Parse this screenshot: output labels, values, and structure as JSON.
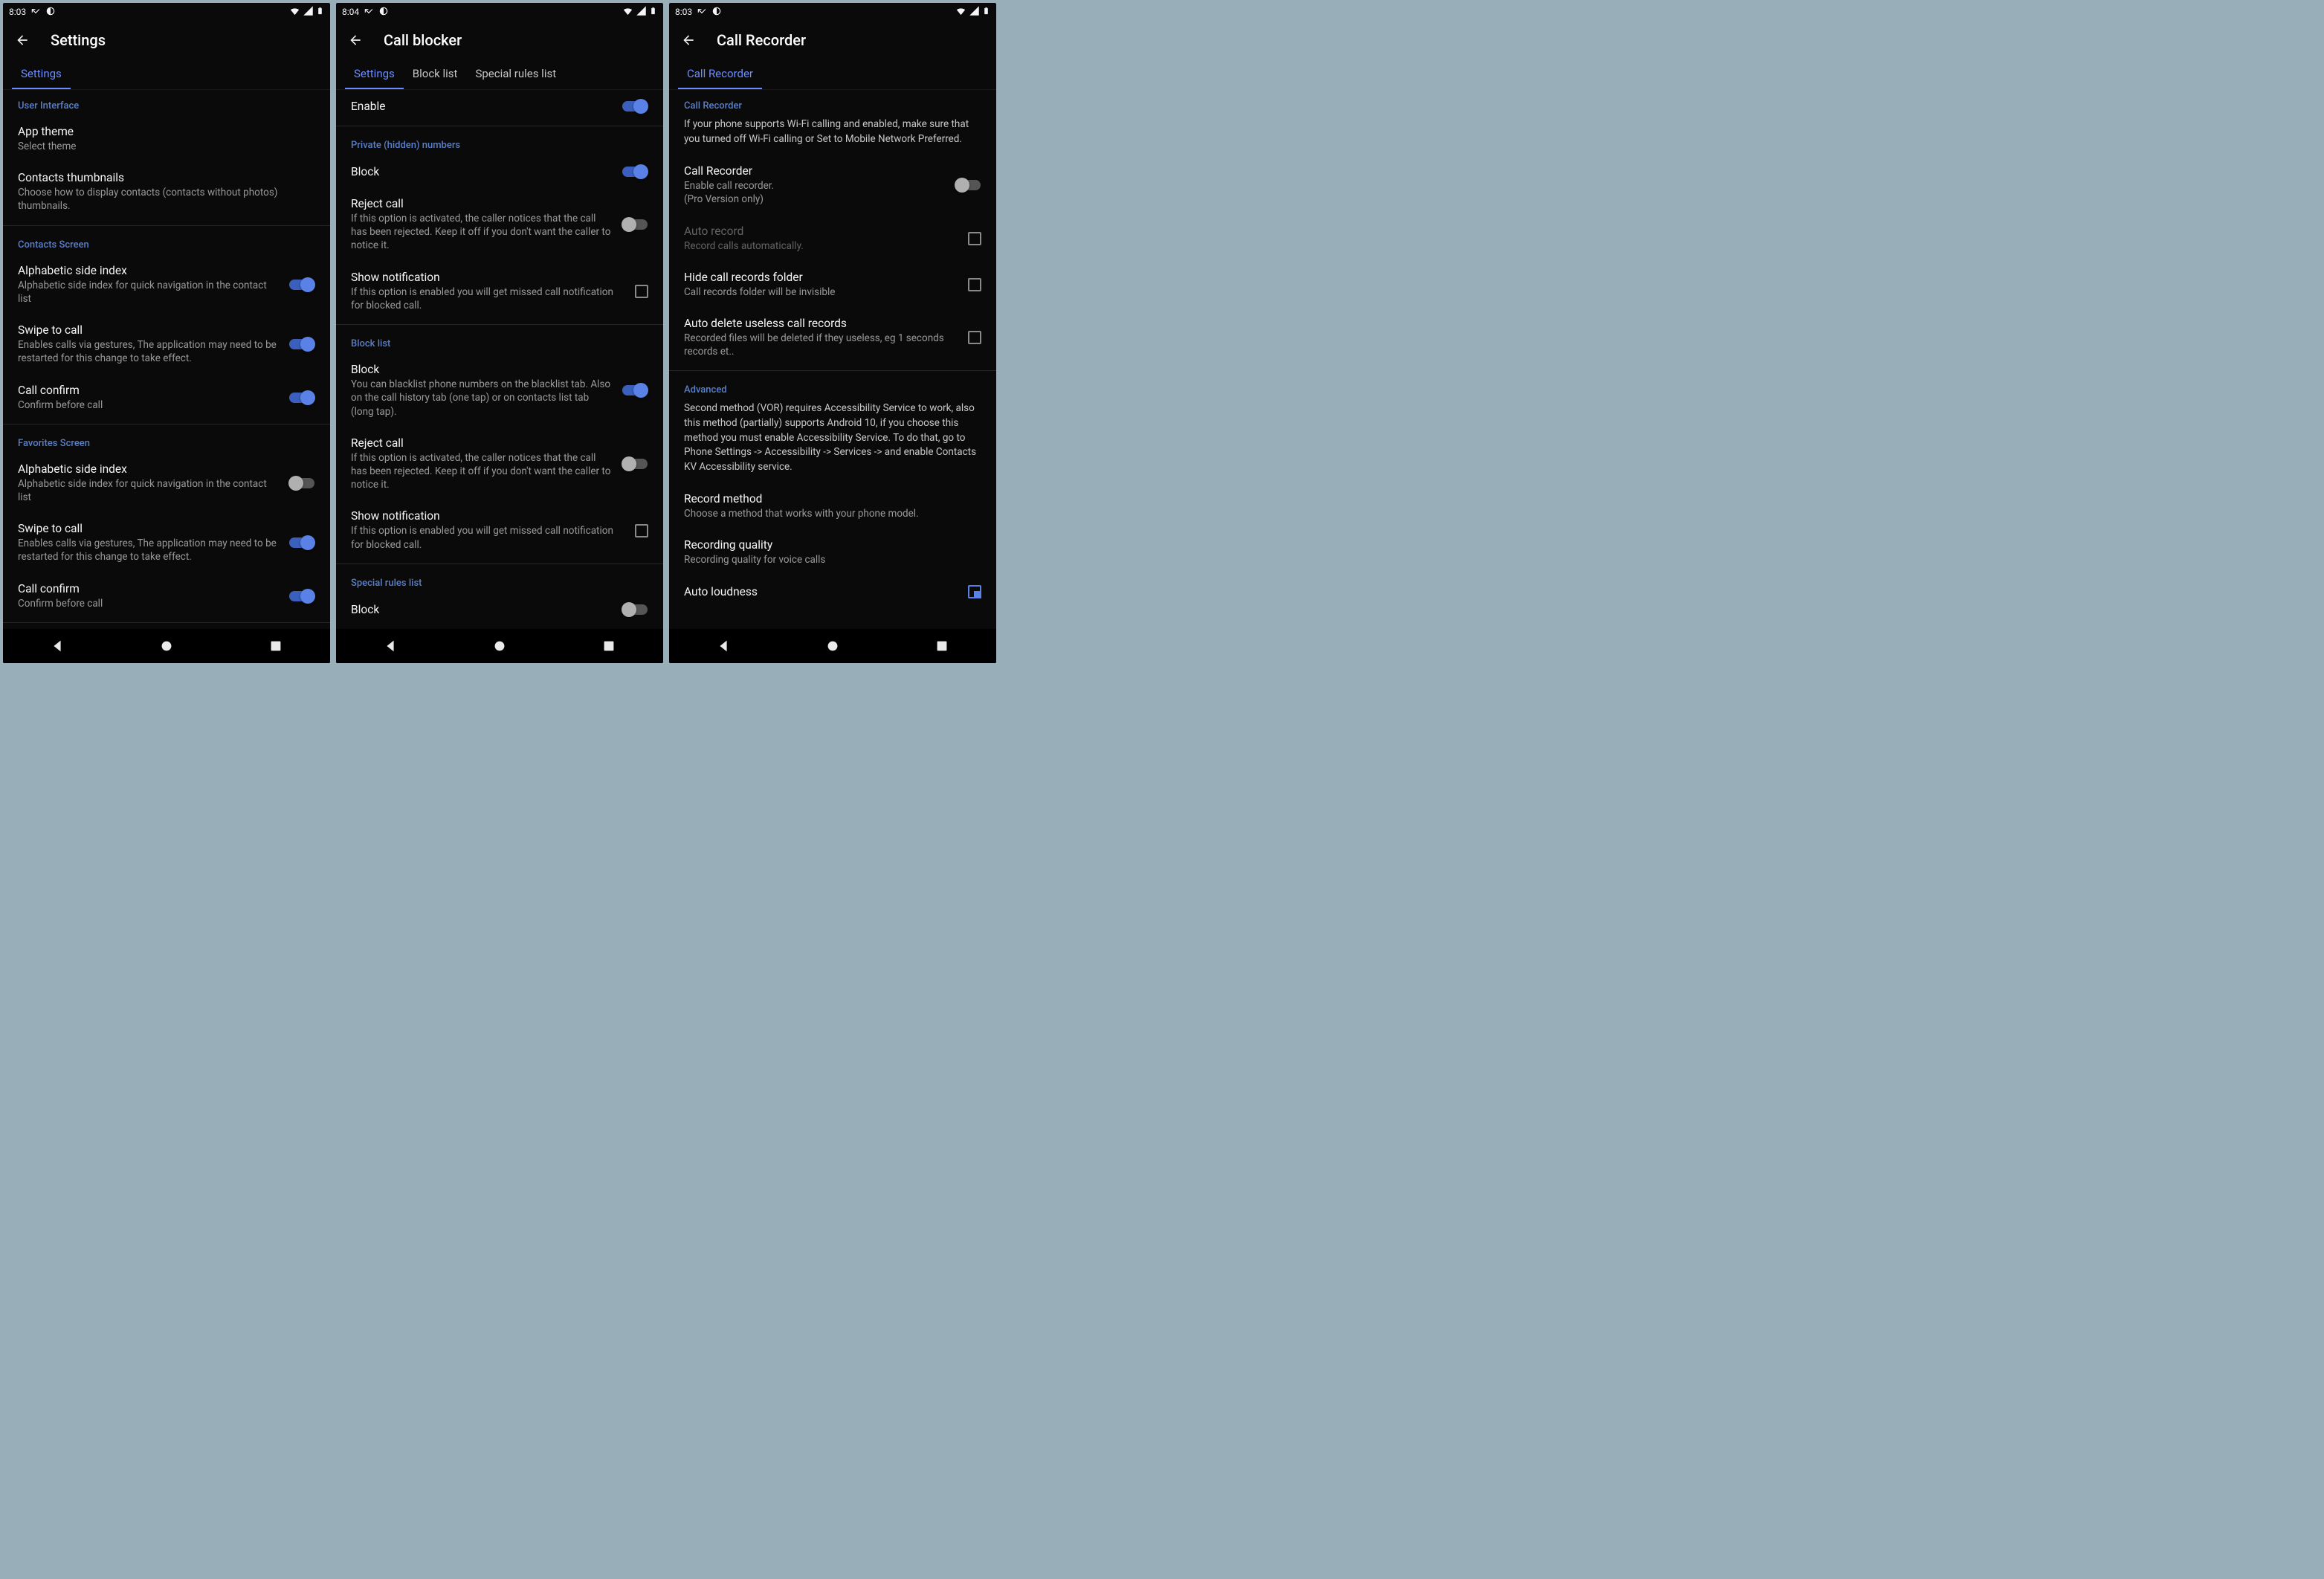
{
  "status_times": [
    "8:03",
    "8:04",
    "8:03"
  ],
  "screens": [
    {
      "title": "Settings",
      "tabs": [
        {
          "label": "Settings",
          "active": true
        }
      ],
      "blocks": [
        {
          "type": "section",
          "label": "User Interface"
        },
        {
          "type": "item",
          "title": "App theme",
          "sub": "Select theme"
        },
        {
          "type": "item",
          "title": "Contacts thumbnails",
          "sub": "Choose how to display contacts (contacts without photos) thumbnails."
        },
        {
          "type": "divider"
        },
        {
          "type": "section",
          "label": "Contacts Screen"
        },
        {
          "type": "item",
          "title": "Alphabetic side index",
          "sub": "Alphabetic side index for quick navigation in the contact list",
          "control": "toggle",
          "on": true
        },
        {
          "type": "item",
          "title": "Swipe to call",
          "sub": "Enables calls via gestures, The application may need to be restarted for this change to take effect.",
          "control": "toggle",
          "on": true
        },
        {
          "type": "item",
          "title": "Call confirm",
          "sub": "Confirm before call",
          "control": "toggle",
          "on": true
        },
        {
          "type": "divider"
        },
        {
          "type": "section",
          "label": "Favorites Screen"
        },
        {
          "type": "item",
          "title": "Alphabetic side index",
          "sub": "Alphabetic side index for quick navigation in the contact list",
          "control": "toggle",
          "on": false
        },
        {
          "type": "item",
          "title": "Swipe to call",
          "sub": "Enables calls via gestures, The application may need to be restarted for this change to take effect.",
          "control": "toggle",
          "on": true
        },
        {
          "type": "item",
          "title": "Call confirm",
          "sub": "Confirm before call",
          "control": "toggle",
          "on": true
        },
        {
          "type": "divider"
        }
      ]
    },
    {
      "title": "Call blocker",
      "tabs": [
        {
          "label": "Settings",
          "active": true
        },
        {
          "label": "Block list",
          "active": false
        },
        {
          "label": "Special rules list",
          "active": false
        }
      ],
      "blocks": [
        {
          "type": "item",
          "title": "Enable",
          "control": "toggle",
          "on": true
        },
        {
          "type": "divider"
        },
        {
          "type": "section",
          "label": "Private (hidden) numbers"
        },
        {
          "type": "item",
          "title": "Block",
          "control": "toggle",
          "on": true
        },
        {
          "type": "item",
          "title": "Reject call",
          "sub": "If this option is activated, the caller notices that the call has been rejected. Keep it off if you don't want the caller to notice it.",
          "control": "toggle",
          "on": false
        },
        {
          "type": "item",
          "title": "Show notification",
          "sub": "If this option is enabled you will get missed call notification for blocked call.",
          "control": "checkbox",
          "on": false
        },
        {
          "type": "divider"
        },
        {
          "type": "section",
          "label": "Block list"
        },
        {
          "type": "item",
          "title": "Block",
          "sub": "You can blacklist phone numbers on the blacklist tab. Also on the call history tab (one tap) or on contacts list tab (long tap).",
          "control": "toggle",
          "on": true
        },
        {
          "type": "item",
          "title": "Reject call",
          "sub": "If this option is activated, the caller notices that the call has been rejected. Keep it off if you don't want the caller to notice it.",
          "control": "toggle",
          "on": false
        },
        {
          "type": "item",
          "title": "Show notification",
          "sub": "If this option is enabled you will get missed call notification for blocked call.",
          "control": "checkbox",
          "on": false
        },
        {
          "type": "divider"
        },
        {
          "type": "section",
          "label": "Special rules list"
        },
        {
          "type": "item",
          "title": "Block",
          "control": "toggle",
          "on": false
        }
      ]
    },
    {
      "title": "Call Recorder",
      "tabs": [
        {
          "label": "Call Recorder",
          "active": true
        }
      ],
      "blocks": [
        {
          "type": "section",
          "label": "Call Recorder"
        },
        {
          "type": "info",
          "text": "If your phone supports Wi-Fi calling and enabled, make sure that you turned off Wi-Fi calling or Set to Mobile Network Preferred."
        },
        {
          "type": "item",
          "title": "Call Recorder",
          "sub": "Enable call recorder.\n(Pro Version only)",
          "control": "toggle",
          "on": false
        },
        {
          "type": "item",
          "title": "Auto record",
          "sub": "Record calls automatically.",
          "control": "checkbox",
          "on": false,
          "disabled": true
        },
        {
          "type": "item",
          "title": "Hide call records folder",
          "sub": "Call records folder will be invisible",
          "control": "checkbox",
          "on": false
        },
        {
          "type": "item",
          "title": "Auto delete useless call records",
          "sub": "Recorded files will be deleted if they useless, eg 1 seconds records et..",
          "control": "checkbox",
          "on": false
        },
        {
          "type": "divider"
        },
        {
          "type": "section",
          "label": "Advanced"
        },
        {
          "type": "info",
          "text": "Second method (VOR) requires Accessibility Service to work, also this method (partially) supports Android 10, if you choose this method you must enable Accessibility Service. To do that, go to Phone Settings -> Accessibility -> Services -> and enable Contacts KV Accessibility service."
        },
        {
          "type": "item",
          "title": "Record method",
          "sub": "Choose a method that works with your phone model."
        },
        {
          "type": "item",
          "title": "Recording quality",
          "sub": "Recording quality for voice calls"
        },
        {
          "type": "item",
          "title": "Auto loudness",
          "control": "checkbox-partial",
          "on": false
        }
      ]
    }
  ]
}
